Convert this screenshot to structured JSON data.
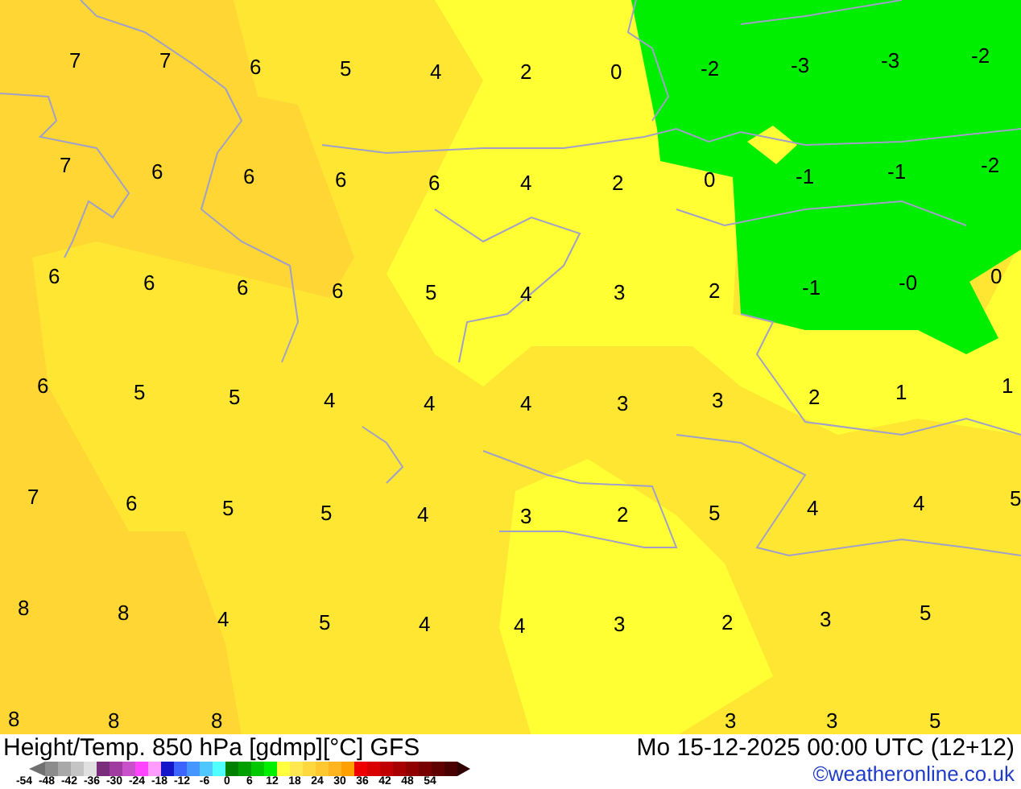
{
  "map": {
    "labels": [
      "7",
      "7",
      "6",
      "5",
      "4",
      "2",
      "0",
      "-2",
      "-3",
      "-3",
      "-2",
      "7",
      "6",
      "6",
      "6",
      "6",
      "4",
      "2",
      "0",
      "-1",
      "-1",
      "-2",
      "6",
      "6",
      "6",
      "6",
      "5",
      "4",
      "3",
      "2",
      "-1",
      "-0",
      "0",
      "6",
      "5",
      "5",
      "4",
      "4",
      "4",
      "3",
      "3",
      "2",
      "1",
      "1",
      "7",
      "6",
      "5",
      "5",
      "4",
      "3",
      "2",
      "5",
      "4",
      "4",
      "5",
      "8",
      "8",
      "4",
      "5",
      "4",
      "4",
      "3",
      "2",
      "3",
      "5",
      "8",
      "8",
      "8",
      "3",
      "3",
      "5"
    ]
  },
  "title": "Height/Temp. 850 hPa [gdmp][°C] GFS",
  "datetime": "Mo 15-12-2025 00:00 UTC (12+12)",
  "legend": {
    "ticks": [
      "-54",
      "-48",
      "-42",
      "-36",
      "-30",
      "-24",
      "-18",
      "-12",
      "-6",
      "0",
      "6",
      "12",
      "18",
      "24",
      "30",
      "36",
      "42",
      "48",
      "54"
    ]
  },
  "copyright": "©weatheronline.co.uk"
}
